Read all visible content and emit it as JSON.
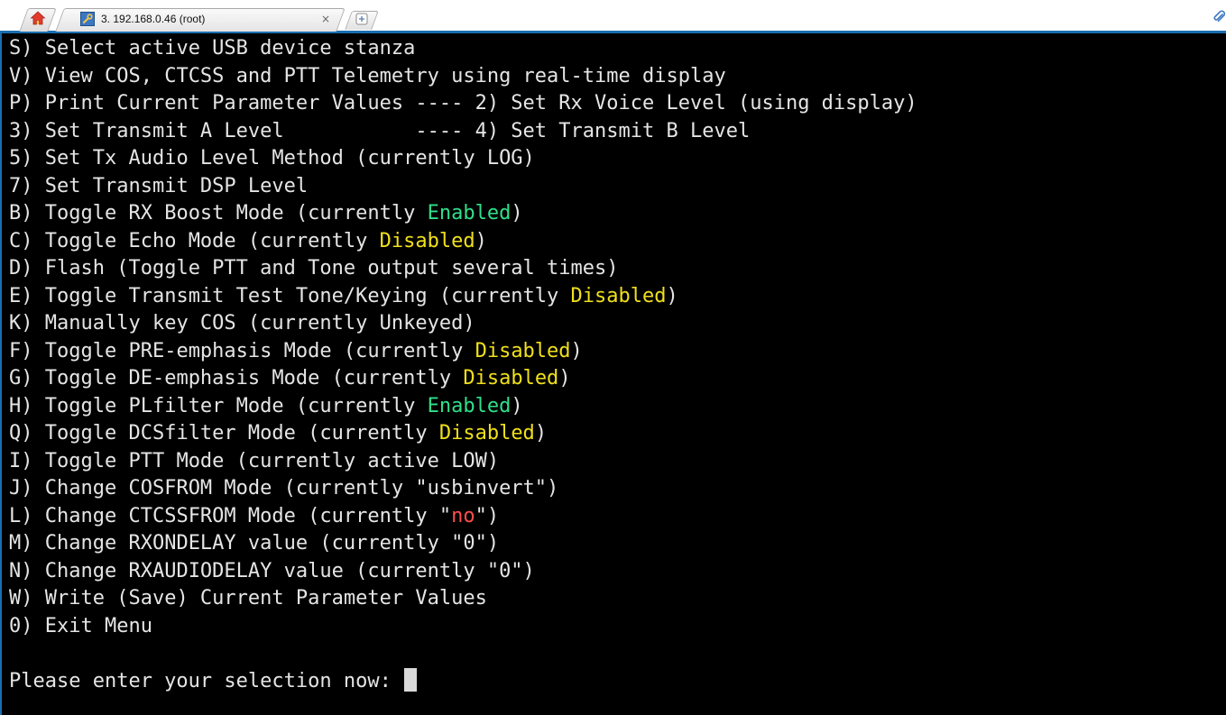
{
  "tabs": {
    "session_title": "3. 192.168.0.46 (root)",
    "close_glyph": "×",
    "home_icon": "home-icon",
    "session_icon": "wrench-icon",
    "new_tab_icon": "new-tab-icon"
  },
  "terminal": {
    "lines": [
      {
        "key": "S)",
        "text": "Select active USB device stanza"
      },
      {
        "key": "V)",
        "text": "View COS, CTCSS and PTT Telemetry using real-time display"
      },
      {
        "key": "P)",
        "text": "Print Current Parameter Values ---- 2) Set Rx Voice Level (using display)"
      },
      {
        "key": "3)",
        "text": "Set Transmit A Level           ---- 4) Set Transmit B Level"
      },
      {
        "key": "5)",
        "text": "Set Tx Audio Level Method (currently LOG)"
      },
      {
        "key": "7)",
        "text": "Set Transmit DSP Level"
      },
      {
        "key": "B)",
        "text": "Toggle RX Boost Mode (currently ",
        "status": "Enabled",
        "status_color": "green",
        "suffix": ")"
      },
      {
        "key": "C)",
        "text": "Toggle Echo Mode (currently ",
        "status": "Disabled",
        "status_color": "yellow",
        "suffix": ")"
      },
      {
        "key": "D)",
        "text": "Flash (Toggle PTT and Tone output several times)"
      },
      {
        "key": "E)",
        "text": "Toggle Transmit Test Tone/Keying (currently ",
        "status": "Disabled",
        "status_color": "yellow",
        "suffix": ")"
      },
      {
        "key": "K)",
        "text": "Manually key COS (currently Unkeyed)"
      },
      {
        "key": "F)",
        "text": "Toggle PRE-emphasis Mode (currently ",
        "status": "Disabled",
        "status_color": "yellow",
        "suffix": ")"
      },
      {
        "key": "G)",
        "text": "Toggle DE-emphasis Mode (currently ",
        "status": "Disabled",
        "status_color": "yellow",
        "suffix": ")"
      },
      {
        "key": "H)",
        "text": "Toggle PLfilter Mode (currently ",
        "status": "Enabled",
        "status_color": "green",
        "suffix": ")"
      },
      {
        "key": "Q)",
        "text": "Toggle DCSfilter Mode (currently ",
        "status": "Disabled",
        "status_color": "yellow",
        "suffix": ")"
      },
      {
        "key": "I)",
        "text": "Toggle PTT Mode (currently active LOW)"
      },
      {
        "key": "J)",
        "text": "Change COSFROM Mode (currently \"usbinvert\")"
      },
      {
        "key": "L)",
        "text": "Change CTCSSFROM Mode (currently \"",
        "status": "no",
        "status_color": "red",
        "suffix": "\")"
      },
      {
        "key": "M)",
        "text": "Change RXONDELAY value (currently \"0\")"
      },
      {
        "key": "N)",
        "text": "Change RXAUDIODELAY value (currently \"0\")"
      },
      {
        "key": "W)",
        "text": "Write (Save) Current Parameter Values"
      },
      {
        "key": "0)",
        "text": "Exit Menu"
      }
    ],
    "prompt": "Please enter your selection now: "
  },
  "colors": {
    "background": "#000000",
    "foreground": "#e5e5e5",
    "green": "#2fe08a",
    "yellow": "#f0e01b",
    "red": "#ff4d4d",
    "accent": "#1b6fb0"
  }
}
